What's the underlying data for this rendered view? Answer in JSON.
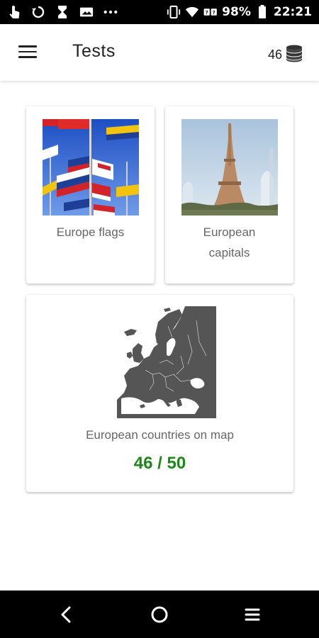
{
  "status_bar": {
    "battery": "98%",
    "time": "22:21",
    "icons": [
      "touch-icon",
      "sync-icon",
      "hourglass-icon",
      "photo-icon",
      "more-dots-icon",
      "vibrate-icon",
      "wifi-icon",
      "no-sim-icon",
      "battery-icon"
    ]
  },
  "appbar": {
    "title": "Tests",
    "coins": "46",
    "menu_icon": "hamburger-menu-icon",
    "coins_icon": "coin-stack-icon"
  },
  "cards": {
    "flags": {
      "label": "Europe flags"
    },
    "capitals": {
      "label_line1": "European",
      "label_line2": "capitals"
    },
    "map": {
      "label": "European countries on map",
      "score": "46 / 50"
    }
  },
  "colors": {
    "score_green": "#1a8a16",
    "label_gray": "#666666",
    "map_gray": "#555555"
  },
  "nav_bar": {
    "icons": [
      "back-icon",
      "home-icon",
      "recents-icon"
    ]
  }
}
